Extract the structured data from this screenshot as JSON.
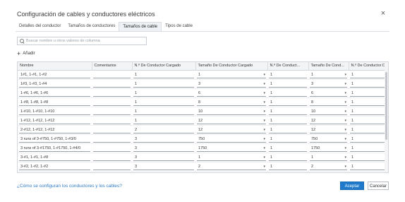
{
  "dialog": {
    "title": "Configuración de cables y conductores eléctricos",
    "close_glyph": "×"
  },
  "tabs": [
    {
      "label": "Detalles del conductor",
      "active": false
    },
    {
      "label": "Tamaños de conductores",
      "active": false
    },
    {
      "label": "Tamaños de cable",
      "active": true
    },
    {
      "label": "Tipos de cable",
      "active": false
    }
  ],
  "search": {
    "placeholder": "Buscar nombre u otros valores de columna",
    "value": ""
  },
  "add": {
    "label": "Añadir",
    "icon": "plus-icon"
  },
  "table": {
    "columns": [
      "Nombre",
      "Comentarios",
      "N.º De Conductor Cargado",
      "Tamaño De Conductor Cargado",
      "N.º De Conduct...",
      "Tamaño De Cond...",
      "N.º De Conductor De"
    ],
    "rows": [
      [
        "1#1, 1-#1, 1-#2",
        "",
        "1",
        "1",
        "1",
        "1",
        "1"
      ],
      [
        "1#3, 1-#3, 1-#4",
        "",
        "1",
        "3",
        "1",
        "3",
        "1"
      ],
      [
        "1-#6, 1-#6, 1-#6",
        "",
        "1",
        "6",
        "1",
        "6",
        "1"
      ],
      [
        "1-#8, 1-#8, 1-#8",
        "",
        "1",
        "8",
        "1",
        "8",
        "1"
      ],
      [
        "1-#10, 1-#10, 1-#10",
        "",
        "1",
        "10",
        "1",
        "10",
        "1"
      ],
      [
        "1-#12, 1-#12, 1-#12",
        "",
        "1",
        "12",
        "1",
        "12",
        "1"
      ],
      [
        "2-#12, 1-#12, 1-#12",
        "",
        "2",
        "12",
        "1",
        "12",
        "1"
      ],
      [
        "3 runs of 3-#750, 1-#750, 1-#3/0",
        "",
        "3",
        "750",
        "1",
        "750",
        "1"
      ],
      [
        "3 runs of 3-#1750, 1-#1750, 1-#4/0",
        "",
        "3",
        "1750",
        "1",
        "1750",
        "1"
      ],
      [
        "3-#1, 1-#1, 1-#8",
        "",
        "3",
        "1",
        "1",
        "1",
        "1"
      ],
      [
        "3-#2, 1-#2, 1-#2",
        "",
        "3",
        "2",
        "1",
        "2",
        "1"
      ]
    ]
  },
  "footer": {
    "help_link": "¿Cómo se configuran los conductores y los cables?",
    "ok_label": "Aceptar",
    "cancel_label": "Cancelar"
  },
  "colors": {
    "accent": "#1f7acb",
    "link": "#2e7bc4"
  }
}
